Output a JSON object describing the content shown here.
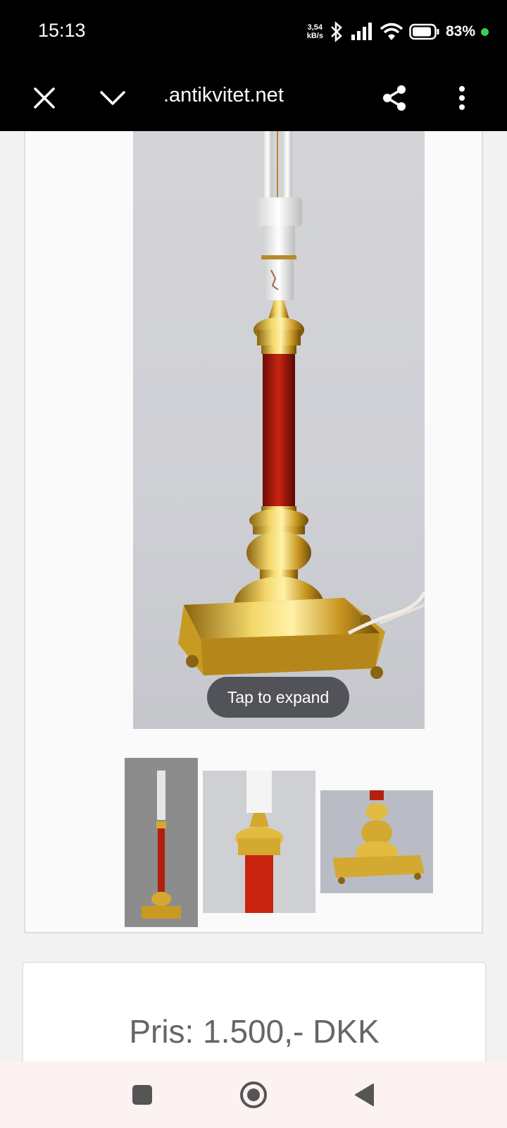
{
  "status_bar": {
    "time": "15:13",
    "net_speed_value": "3,54",
    "net_speed_unit": "kB/s",
    "battery": "83%",
    "indicator_color": "#3ecf4a"
  },
  "toolbar": {
    "url": ".antikvitet.net",
    "close_icon": "close-icon",
    "collapse_icon": "chevron-down-icon",
    "share_icon": "share-icon",
    "menu_icon": "more-vert-icon"
  },
  "gallery": {
    "expand_label": "Tap to expand",
    "thumbnails": [
      "full-lamp",
      "lamp-top-detail",
      "lamp-base-detail"
    ]
  },
  "price": {
    "label": "Pris: 1.500,- DKK"
  },
  "nav": {
    "recents_icon": "square-icon",
    "home_icon": "circle-icon",
    "back_icon": "back-triangle-icon"
  }
}
